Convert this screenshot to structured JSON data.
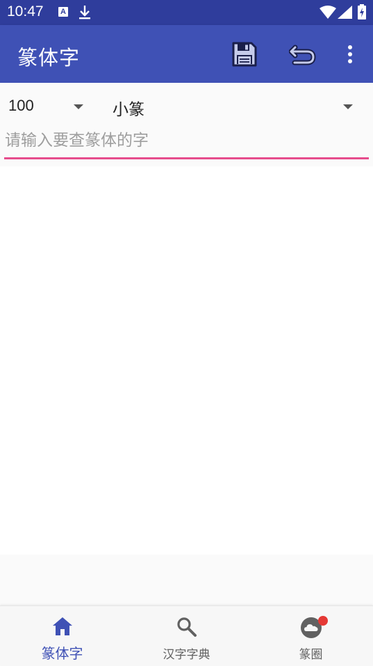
{
  "status_bar": {
    "time": "10:47",
    "icons": [
      "app-a-icon",
      "download-icon",
      "wifi-icon",
      "cell-signal-icon",
      "battery-charging-icon"
    ]
  },
  "app_bar": {
    "title": "篆体字",
    "actions": [
      "save-icon",
      "undo-icon",
      "more-vert-icon"
    ]
  },
  "controls": {
    "size_value": "100",
    "style_value": "小篆",
    "search_placeholder": "请输入要查篆体的字",
    "search_value": ""
  },
  "bottom_nav": {
    "items": [
      {
        "label": "篆体字",
        "icon": "home-icon",
        "active": true
      },
      {
        "label": "汉字字典",
        "icon": "search-icon",
        "active": false
      },
      {
        "label": "篆圈",
        "icon": "cloud-icon",
        "active": false,
        "badge": true
      }
    ]
  },
  "colors": {
    "primary": "#3f51b5",
    "primary_dark": "#2f3d9c",
    "accent": "#e64c8c",
    "badge": "#e53935"
  }
}
